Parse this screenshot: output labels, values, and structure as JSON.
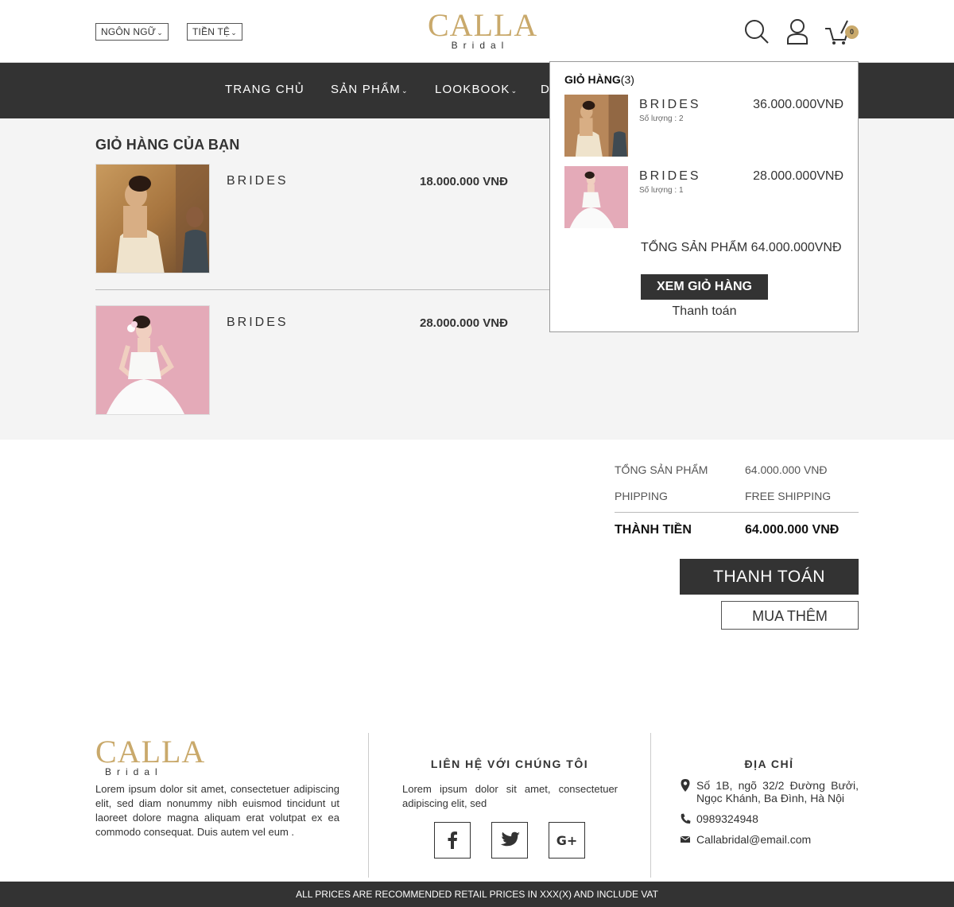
{
  "header": {
    "language_label": "NGÔN NGỮ",
    "currency_label": "TIỀN TỆ",
    "logo_main": "CALLA",
    "logo_sub": "Bridal",
    "cart_count": "0"
  },
  "nav": {
    "items": [
      {
        "label": "TRANG CHỦ",
        "has_dropdown": false
      },
      {
        "label": "SẢN PHẨM",
        "has_dropdown": true
      },
      {
        "label": "LOOKBOOK",
        "has_dropdown": true
      },
      {
        "label": "D",
        "has_dropdown": false
      }
    ]
  },
  "cart": {
    "title": "GIỎ HÀNG CỦA BẠN",
    "items": [
      {
        "name": "BRIDES",
        "price": "18.000.000 VNĐ"
      },
      {
        "name": "BRIDES",
        "price": "28.000.000 VNĐ"
      }
    ]
  },
  "summary": {
    "subtotal_label": "TỔNG SẢN PHẨM",
    "subtotal_value": "64.000.000 VNĐ",
    "shipping_label": "PHIPPING",
    "shipping_value": "FREE SHIPPING",
    "total_label": "THÀNH TIỀN",
    "total_value": "64.000.000 VNĐ",
    "checkout_button": "THANH TOÁN",
    "continue_button": "MUA THÊM"
  },
  "dropdown": {
    "title": "GIỎ HÀNG",
    "count": "(3)",
    "items": [
      {
        "name": "BRIDES",
        "qty": "Số lượng : 2",
        "price": "36.000.000VNĐ"
      },
      {
        "name": "BRIDES",
        "qty": "Số lượng : 1",
        "price": "28.000.000VNĐ"
      }
    ],
    "total": "TỔNG SẢN PHẨM  64.000.000VNĐ",
    "view_button": "XEM GIỎ HÀNG",
    "checkout_link": "Thanh toán"
  },
  "footer": {
    "logo_main": "CALLA",
    "logo_sub": "Bridal",
    "about_text": "Lorem ipsum dolor sit amet, consectetuer adipiscing elit, sed diam nonummy nibh euismod tincidunt ut laoreet dolore magna aliquam erat volutpat ex ea commodo consequat. Duis autem vel eum .",
    "contact_heading": "LIÊN HỆ VỚI CHÚNG TÔI",
    "contact_text": "Lorem ipsum dolor sit amet, consectetuer adipiscing elit, sed",
    "social": [
      "facebook-icon",
      "twitter-icon",
      "google-plus-icon"
    ],
    "address_heading": "ĐỊA CHỈ",
    "address": "Số 1B, ngõ 32/2 Đường Bưởi, Ngọc Khánh, Ba Đình, Hà Nội",
    "phone": "0989324948",
    "email": "Callabridal@email.com",
    "bottom_notice": "ALL PRICES ARE RECOMMENDED RETAIL PRICES IN XXX(X) AND INCLUDE VAT"
  },
  "colors": {
    "accent": "#c9a96b",
    "dark": "#333333",
    "content_bg": "#f4f4f4"
  }
}
